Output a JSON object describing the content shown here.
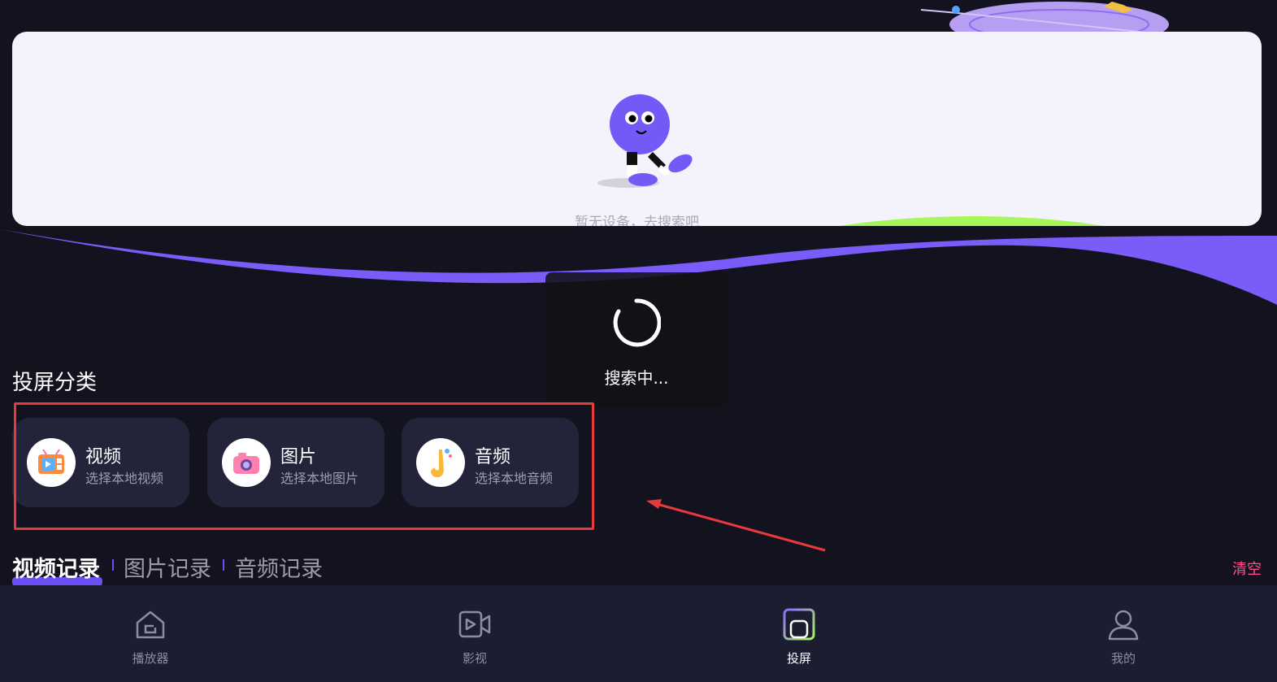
{
  "device_panel": {
    "empty_text": "暂无设备，去搜索吧"
  },
  "loading_toast": {
    "text": "搜索中..."
  },
  "categories": {
    "title": "投屏分类",
    "items": [
      {
        "title": "视频",
        "subtitle": "选择本地视频",
        "icon": "tv-icon"
      },
      {
        "title": "图片",
        "subtitle": "选择本地图片",
        "icon": "camera-icon"
      },
      {
        "title": "音频",
        "subtitle": "选择本地音频",
        "icon": "saxophone-icon"
      }
    ]
  },
  "records": {
    "tabs": [
      {
        "label": "视频记录",
        "active": true
      },
      {
        "label": "图片记录",
        "active": false
      },
      {
        "label": "音频记录",
        "active": false
      }
    ],
    "clear_label": "清空"
  },
  "bottom_nav": {
    "items": [
      {
        "label": "播放器",
        "icon": "home-icon",
        "active": false
      },
      {
        "label": "影视",
        "icon": "video-icon",
        "active": false
      },
      {
        "label": "投屏",
        "icon": "cast-icon",
        "active": true
      },
      {
        "label": "我的",
        "icon": "user-icon",
        "active": false
      }
    ]
  },
  "colors": {
    "background": "#13131f",
    "accent_purple": "#6c4ff6",
    "card_bg": "#23243a",
    "clear_pink": "#ff4f8d",
    "annotation_red": "#e8393b",
    "green_arc": "#a6f75b"
  }
}
